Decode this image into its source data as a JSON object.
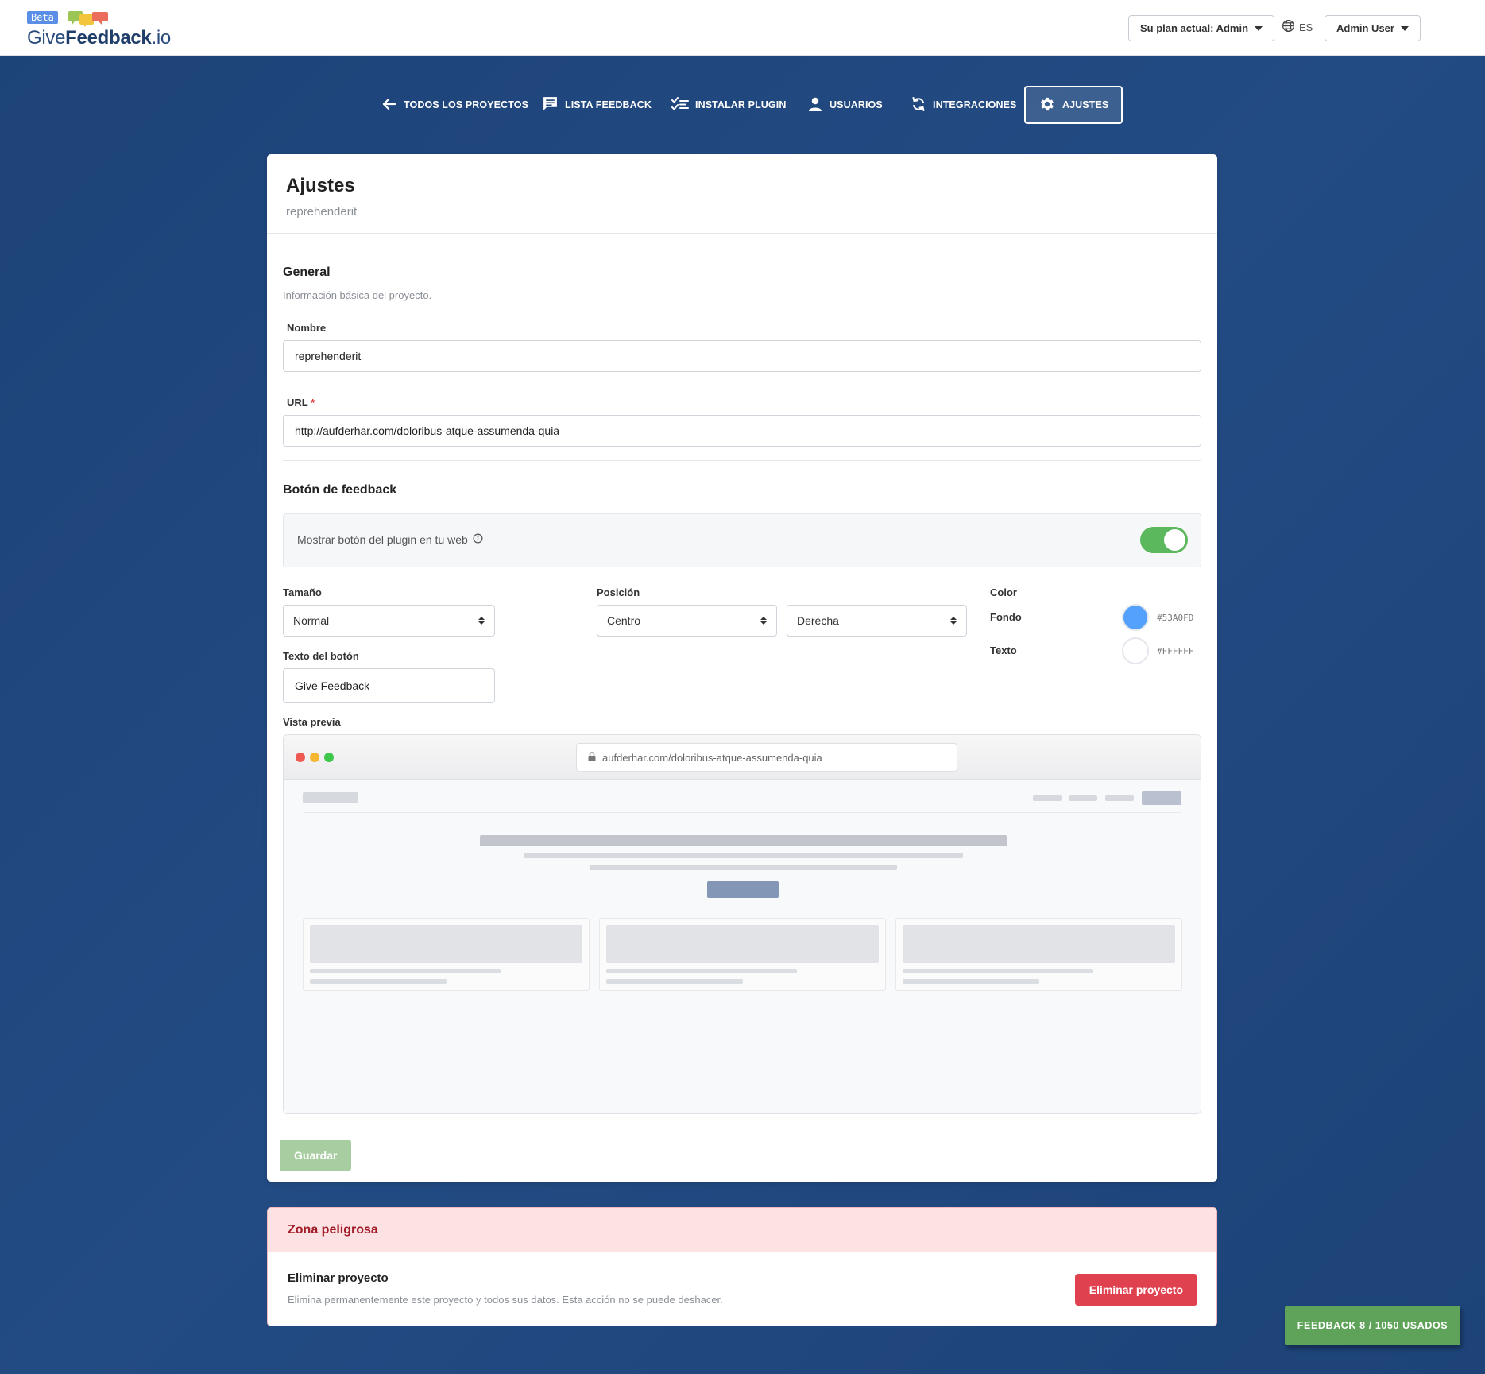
{
  "header": {
    "beta_label": "Beta",
    "brand_prefix": "Give",
    "brand_bold": "Feedback",
    "brand_suffix": ".io",
    "plan_label": "Su plan actual: Admin",
    "language": "ES",
    "user_label": "Admin User"
  },
  "nav": {
    "items": [
      {
        "label": "Todos los proyectos",
        "icon": "arrow-left-icon"
      },
      {
        "label": "Lista feedback",
        "icon": "chat-icon"
      },
      {
        "label": "Instalar plugin",
        "icon": "checklist-icon"
      },
      {
        "label": "Usuarios",
        "icon": "person-icon"
      },
      {
        "label": "Integraciones",
        "icon": "sync-icon"
      },
      {
        "label": "Ajustes",
        "icon": "gear-icon",
        "active": true
      }
    ]
  },
  "page": {
    "title": "Ajustes",
    "subtitle": "reprehenderit"
  },
  "general": {
    "title": "General",
    "description": "Información básica del proyecto.",
    "name_label": "Nombre",
    "name_value": "reprehenderit",
    "url_label": "URL",
    "url_required_mark": "*",
    "url_value": "http://aufderhar.com/doloribus-atque-assumenda-quia"
  },
  "feedback_button": {
    "title": "Botón de feedback",
    "show_label": "Mostrar botón del plugin en tu web",
    "show_enabled": true,
    "size_label": "Tamaño",
    "size_value": "Normal",
    "position_label": "Posición",
    "position_vertical": "Centro",
    "position_horizontal": "Derecha",
    "color_label": "Color",
    "background_label": "Fondo",
    "background_hex": "#53A0FD",
    "text_label": "Texto",
    "text_hex": "#FFFFFF",
    "button_text_label": "Texto del botón",
    "button_text_value": "Give Feedback",
    "preview_label": "Vista previa",
    "preview_url": "aufderhar.com/doloribus-atque-assumenda-quia"
  },
  "actions": {
    "save_label": "Guardar"
  },
  "danger_zone": {
    "title": "Zona peligrosa",
    "delete_title": "Eliminar proyecto",
    "delete_description": "Elimina permanentemente este proyecto y todos sus datos. Esta acción no se puede deshacer.",
    "delete_button": "Eliminar proyecto"
  },
  "usage": {
    "label": "Feedback 8 / 1050 usados"
  },
  "colors": {
    "accent_blue": "#53A0FD",
    "success_green": "#5cb85c",
    "danger_red": "#e0414f",
    "nav_background": "#1d4378"
  }
}
